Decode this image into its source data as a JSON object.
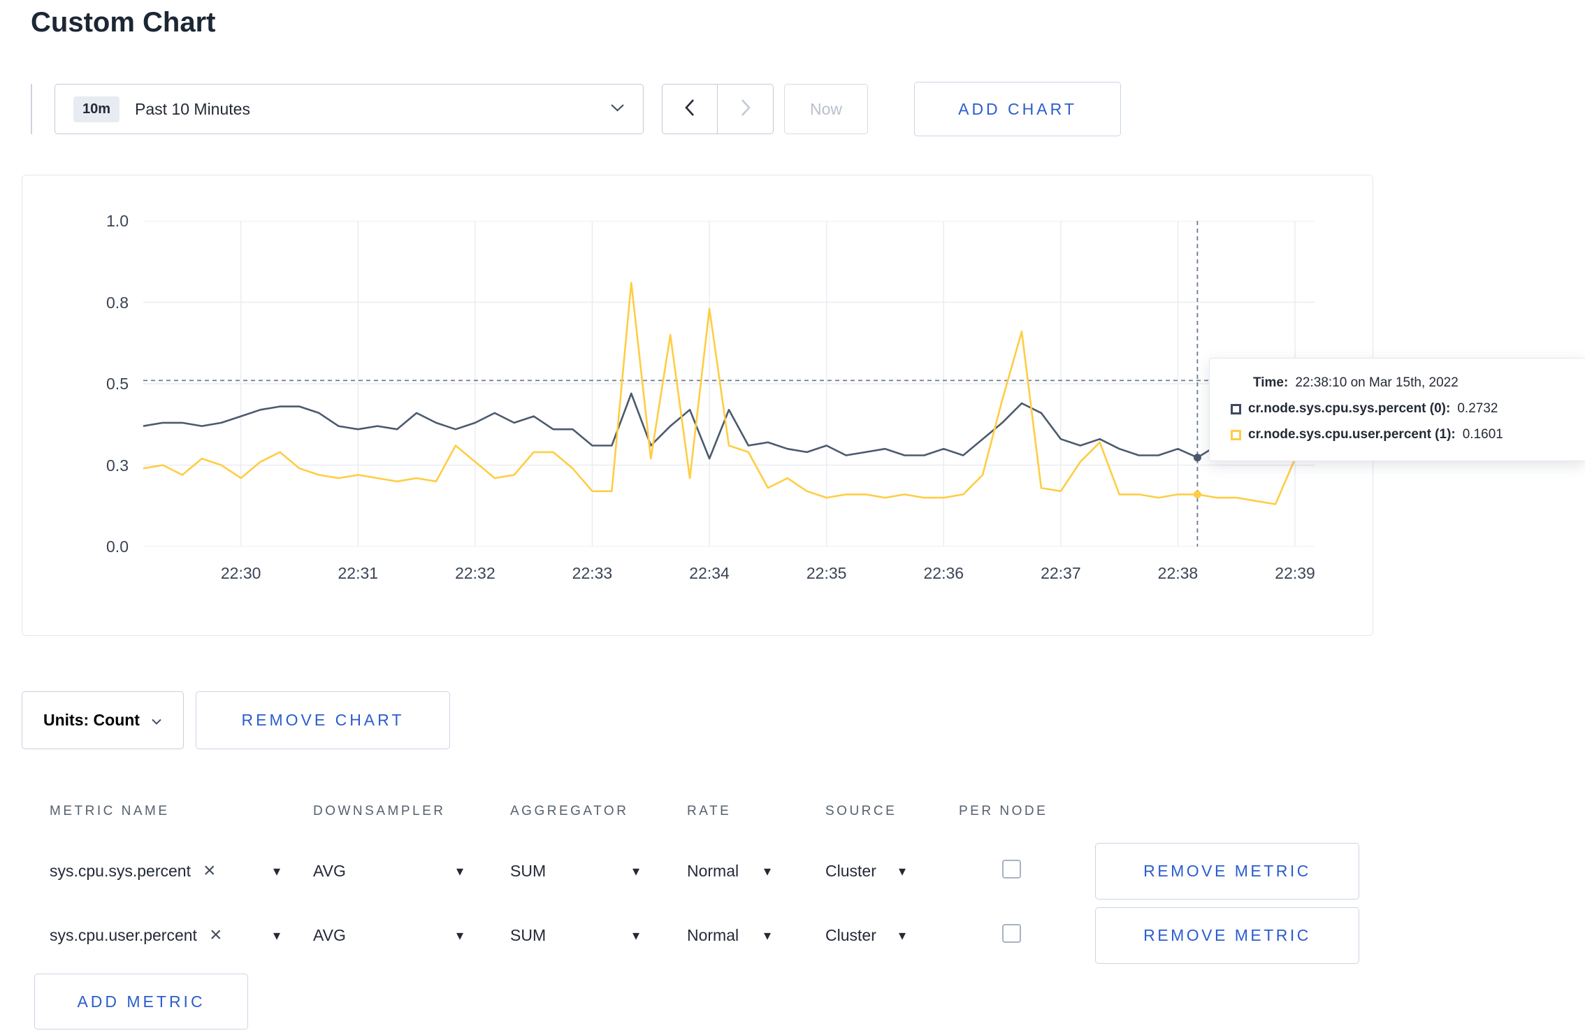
{
  "page": {
    "title": "Custom Chart"
  },
  "toolbar": {
    "time_badge": "10m",
    "time_label": "Past 10 Minutes",
    "now_label": "Now",
    "add_chart_label": "ADD CHART"
  },
  "tooltip": {
    "time_label": "Time:",
    "time_value": "22:38:10 on Mar 15th, 2022",
    "series": [
      {
        "name": "cr.node.sys.cpu.sys.percent (0):",
        "value": "0.2732",
        "color": "#3c4a61"
      },
      {
        "name": "cr.node.sys.cpu.user.percent (1):",
        "value": "0.1601",
        "color": "#ffcd43"
      }
    ]
  },
  "chart_controls": {
    "units_label": "Units: Count",
    "remove_chart_label": "REMOVE CHART"
  },
  "metrics_table": {
    "headers": [
      "METRIC NAME",
      "DOWNSAMPLER",
      "AGGREGATOR",
      "RATE",
      "SOURCE",
      "PER NODE"
    ],
    "rows": [
      {
        "metric": "sys.cpu.sys.percent",
        "downsampler": "AVG",
        "aggregator": "SUM",
        "rate": "Normal",
        "source": "Cluster",
        "per_node_checked": false,
        "remove_label": "REMOVE METRIC"
      },
      {
        "metric": "sys.cpu.user.percent",
        "downsampler": "AVG",
        "aggregator": "SUM",
        "rate": "Normal",
        "source": "Cluster",
        "per_node_checked": false,
        "remove_label": "REMOVE METRIC"
      }
    ],
    "add_metric_label": "ADD METRIC"
  },
  "chart_data": {
    "type": "line",
    "title": "",
    "ylim": [
      0,
      1.0
    ],
    "y_gridlines": [
      0,
      0.25,
      0.5,
      0.75,
      1.0
    ],
    "y_tick_labels": [
      "0.0",
      "0.3",
      "0.5",
      "0.8",
      "1.0"
    ],
    "x_ticks": [
      "22:30",
      "22:31",
      "22:32",
      "22:33",
      "22:34",
      "22:35",
      "22:36",
      "22:37",
      "22:38",
      "22:39"
    ],
    "x_tick_offsets_s": [
      50,
      110,
      170,
      230,
      290,
      350,
      410,
      470,
      530,
      590
    ],
    "domain_s": [
      0,
      600
    ],
    "start_time": "22:29:10",
    "interval_s": 10,
    "grid_color": "#e9ecf2",
    "series": [
      {
        "name": "cr.node.sys.cpu.sys.percent",
        "color": "#4b5a6e",
        "values": [
          0.37,
          0.38,
          0.38,
          0.37,
          0.38,
          0.4,
          0.42,
          0.43,
          0.43,
          0.41,
          0.37,
          0.36,
          0.37,
          0.36,
          0.41,
          0.38,
          0.36,
          0.38,
          0.41,
          0.38,
          0.4,
          0.36,
          0.36,
          0.31,
          0.31,
          0.47,
          0.31,
          0.37,
          0.42,
          0.27,
          0.42,
          0.31,
          0.32,
          0.3,
          0.29,
          0.31,
          0.28,
          0.29,
          0.3,
          0.28,
          0.28,
          0.3,
          0.28,
          0.33,
          0.38,
          0.44,
          0.41,
          0.33,
          0.31,
          0.33,
          0.3,
          0.28,
          0.28,
          0.3,
          0.2732,
          0.31,
          0.33,
          0.3,
          0.3,
          0.31
        ]
      },
      {
        "name": "cr.node.sys.cpu.user.percent",
        "color": "#ffcd43",
        "values": [
          0.24,
          0.25,
          0.22,
          0.27,
          0.25,
          0.21,
          0.26,
          0.29,
          0.24,
          0.22,
          0.21,
          0.22,
          0.21,
          0.2,
          0.21,
          0.2,
          0.31,
          0.26,
          0.21,
          0.22,
          0.29,
          0.29,
          0.24,
          0.17,
          0.17,
          0.81,
          0.27,
          0.65,
          0.21,
          0.73,
          0.31,
          0.29,
          0.18,
          0.21,
          0.17,
          0.15,
          0.16,
          0.16,
          0.15,
          0.16,
          0.15,
          0.15,
          0.16,
          0.22,
          0.45,
          0.66,
          0.18,
          0.17,
          0.26,
          0.32,
          0.16,
          0.16,
          0.15,
          0.16,
          0.1601,
          0.15,
          0.15,
          0.14,
          0.13,
          0.27
        ]
      }
    ],
    "crosshair": {
      "time": "22:38:10",
      "offset_s": 540,
      "index": 54,
      "guide_value": 0.51,
      "values": {
        "sys": 0.2732,
        "user": 0.1601
      }
    }
  }
}
